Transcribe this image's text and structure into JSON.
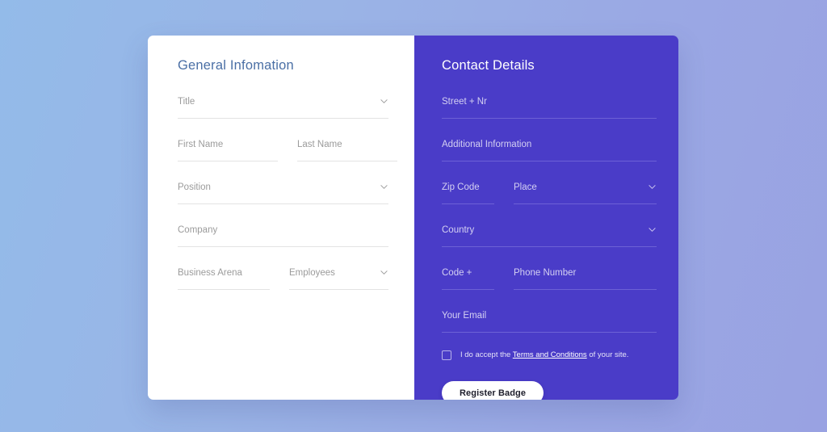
{
  "theme": {
    "background_gradient_from": "#93bbe9",
    "background_gradient_to": "#99a2e2",
    "panel_purple": "#4a3cc8",
    "panel_white": "#ffffff",
    "heading_blue": "#4a6fa5",
    "placeholder_gray": "#9b9b9b",
    "placeholder_light": "#d4d0f2"
  },
  "left_panel": {
    "heading": "General Infomation",
    "fields": {
      "title": {
        "placeholder": "Title",
        "value": "",
        "type": "select"
      },
      "first_name": {
        "placeholder": "First Name",
        "value": "",
        "type": "text"
      },
      "last_name": {
        "placeholder": "Last Name",
        "value": "",
        "type": "text"
      },
      "position": {
        "placeholder": "Position",
        "value": "",
        "type": "select"
      },
      "company": {
        "placeholder": "Company",
        "value": "",
        "type": "text"
      },
      "business_arena": {
        "placeholder": "Business Arena",
        "value": "",
        "type": "text"
      },
      "employees": {
        "placeholder": "Employees",
        "value": "",
        "type": "select"
      }
    }
  },
  "right_panel": {
    "heading": "Contact Details",
    "fields": {
      "street": {
        "placeholder": "Street + Nr",
        "value": "",
        "type": "text"
      },
      "additional_information": {
        "placeholder": "Additional Information",
        "value": "",
        "type": "text"
      },
      "zip_code": {
        "placeholder": "Zip Code",
        "value": "",
        "type": "text"
      },
      "place": {
        "placeholder": "Place",
        "value": "",
        "type": "select"
      },
      "country": {
        "placeholder": "Country",
        "value": "",
        "type": "select"
      },
      "code": {
        "placeholder": "Code +",
        "value": "",
        "type": "text"
      },
      "phone_number": {
        "placeholder": "Phone Number",
        "value": "",
        "type": "text"
      },
      "email": {
        "placeholder": "Your Email",
        "value": "",
        "type": "text"
      }
    },
    "terms": {
      "checked": false,
      "text_before": "I do accept the",
      "link_text": "Terms and Conditions",
      "text_after": "of your site."
    },
    "submit_button": {
      "label": "Register Badge"
    }
  },
  "icons": {
    "chevron_down": "chevron-down-icon",
    "checkbox_empty": "checkbox-unchecked-icon"
  }
}
